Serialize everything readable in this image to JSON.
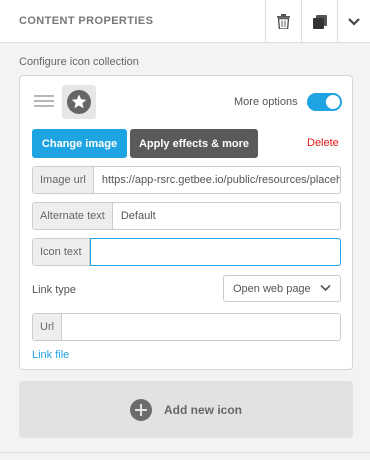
{
  "header": {
    "title": "CONTENT PROPERTIES",
    "icons": [
      "trash-icon",
      "duplicate-icon",
      "chevron-down-icon"
    ]
  },
  "section": {
    "label": "Configure icon collection"
  },
  "item": {
    "thumbnail_icon": "star-icon",
    "more_options": {
      "label": "More options",
      "enabled": true
    },
    "buttons": {
      "change_image": "Change image",
      "apply_effects": "Apply effects & more",
      "delete": "Delete"
    },
    "fields": {
      "image_url": {
        "label": "Image url",
        "value": "https://app-rsrc.getbee.io/public/resources/placeholders/"
      },
      "alternate_text": {
        "label": "Alternate text",
        "value": "Default"
      },
      "icon_text": {
        "label": "Icon text",
        "value": ""
      },
      "url": {
        "label": "Url",
        "value": ""
      }
    },
    "link_type": {
      "label": "Link type",
      "selected": "Open web page"
    },
    "link_file": "Link file"
  },
  "add_button": {
    "label": "Add new icon"
  },
  "colors": {
    "accent": "#1fa4e3",
    "delete": "#e01a1a",
    "dark_button": "#5a5a5a"
  }
}
